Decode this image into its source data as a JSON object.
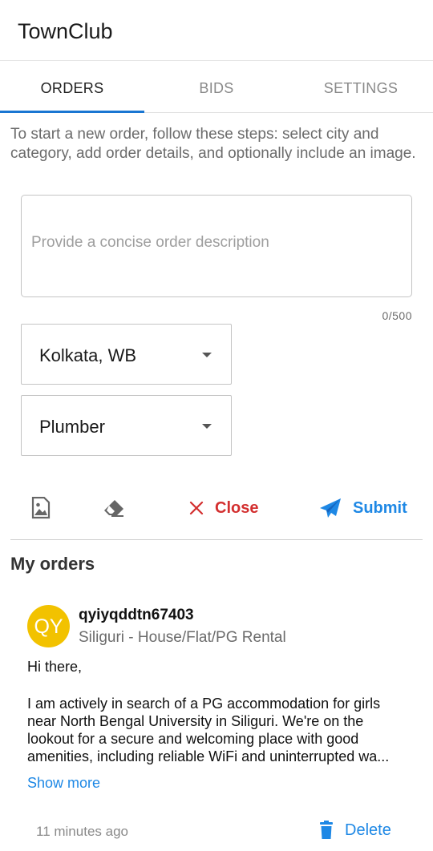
{
  "app": {
    "title": "TownClub"
  },
  "tabs": [
    {
      "label": "ORDERS",
      "active": true
    },
    {
      "label": "BIDS",
      "active": false
    },
    {
      "label": "SETTINGS",
      "active": false
    }
  ],
  "new_order": {
    "instructions": "To start a new order, follow these steps: select city and category, add order details, and optionally include an image.",
    "description": {
      "value": "",
      "placeholder": "Provide a concise order description",
      "counter": "0/500"
    },
    "city": {
      "selected": "Kolkata, WB"
    },
    "category": {
      "selected": "Plumber"
    },
    "toolbar": {
      "image_icon": "add-image-icon",
      "eraser_icon": "eraser-icon",
      "close_label": "Close",
      "submit_label": "Submit"
    }
  },
  "my_orders": {
    "title": "My orders",
    "items": [
      {
        "avatar_initials": "QY",
        "avatar_color": "#f2c200",
        "username": "qyiyqddtn67403",
        "subtitle": "Siliguri - House/Flat/PG Rental",
        "greeting": "Hi there,",
        "body": "I am actively in search of a PG accommodation for girls near North Bengal University in Siliguri. We're on the lookout for a secure and welcoming place with good amenities, including reliable WiFi and uninterrupted wa...",
        "show_more_label": "Show more",
        "time": "11 minutes ago",
        "delete_label": "Delete"
      }
    ]
  },
  "colors": {
    "accent": "#1976d2",
    "link": "#1e88e5",
    "danger": "#d32f2f",
    "avatar": "#f2c200"
  }
}
